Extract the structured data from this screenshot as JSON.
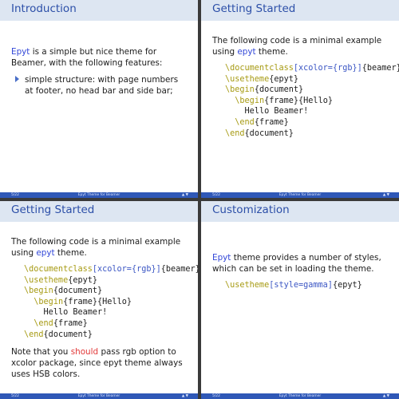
{
  "footer": {
    "page": "5/22",
    "title": "Epyt Theme for Beamer",
    "nav": "▲ ▼"
  },
  "slide1": {
    "title": "Introduction",
    "intro_link": "Epyt",
    "intro_rest": " is a simple but nice theme for Beamer, with the following features:",
    "bullet": "simple structure: with page numbers at footer, no head bar and side bar;"
  },
  "slide2": {
    "title": "Getting Started",
    "text_before": "The following code is a minimal example using ",
    "text_link": "epyt",
    "text_after": " theme."
  },
  "slide3": {
    "title": "Getting Started",
    "text_before": "The following code is a minimal example using ",
    "text_link": "epyt",
    "text_after": " theme.",
    "note_before": "Note that you ",
    "note_red": "should",
    "note_after": " pass rgb option to xcolor package, since epyt theme always uses HSB colors."
  },
  "slide4": {
    "title": "Customization",
    "text_link": "Epyt",
    "text_rest": " theme provides a number of styles, which can be set in loading the theme."
  },
  "code": {
    "documentclass": "\\documentclass",
    "xcolor_opt": "[xcolor={rgb}]",
    "beamer_arg": "{beamer}",
    "usetheme": "\\usetheme",
    "epyt_arg": "{epyt}",
    "begin": "\\begin",
    "end": "\\end",
    "document_arg": "{document}",
    "frame_arg": "{frame}",
    "hello_arg": "{Hello}",
    "hello_text": "Hello Beamer!",
    "style_opt": "[style=gamma]"
  }
}
